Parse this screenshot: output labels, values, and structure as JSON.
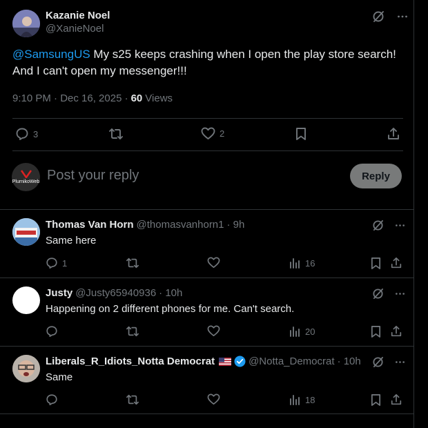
{
  "main_tweet": {
    "author_name": "Kazanie Noel",
    "author_handle": "@XanieNoel",
    "mention": "@SamsungUS",
    "text_line1": " My s25 keeps crashing when I open the play store search!",
    "text_line2": "And I can't open my messenger!!!",
    "timestamp": "9:10 PM · Dec 16, 2025 · ",
    "views_count": "60",
    "views_label": "Views",
    "reply_count": "3",
    "like_count": "2"
  },
  "composer": {
    "avatar_text": "PlurnikoWeb",
    "placeholder": "Post your reply",
    "reply_button": "Reply"
  },
  "replies": [
    {
      "name": "Thomas Van Horn",
      "handle": "@thomasvanhorn1",
      "time": "· 9h",
      "text": "Same here",
      "reply_count": "1",
      "views": "16",
      "verified": false
    },
    {
      "name": "Justy",
      "handle": "@Justy65940936",
      "time": "· 10h",
      "text": "Happening on 2 different phones for me. Can't search.",
      "reply_count": "",
      "views": "20",
      "verified": false
    },
    {
      "name": "Liberals_R_Idiots_Notta Democrat",
      "handle": "@Notta_Democrat",
      "time": "· 10h",
      "text": "Same",
      "reply_count": "",
      "views": "18",
      "verified": true
    }
  ],
  "colors": {
    "background": "#000000",
    "text": "#e7e9ea",
    "secondary": "#71767b",
    "link": "#1d9bf0",
    "divider": "#2f3336"
  }
}
